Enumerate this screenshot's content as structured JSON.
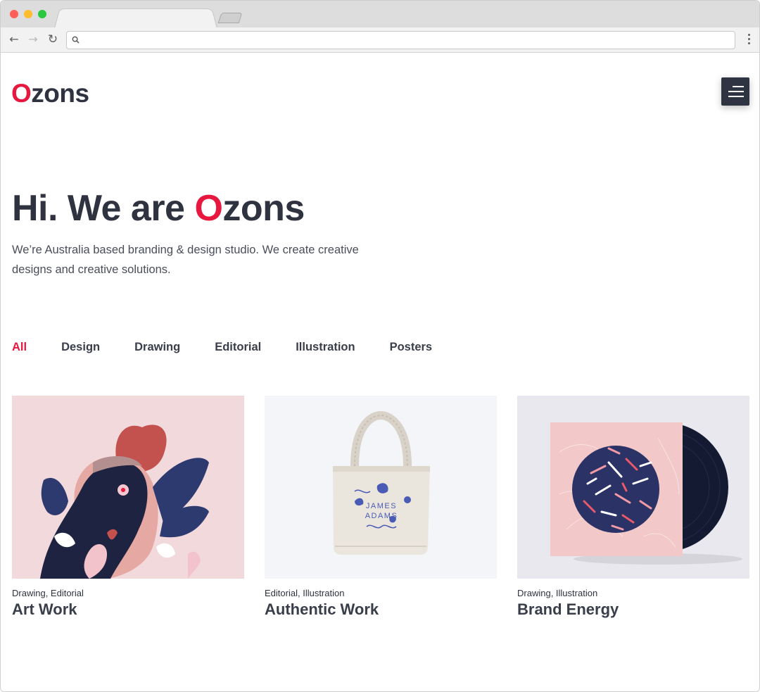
{
  "browser": {
    "url": ""
  },
  "site": {
    "logo_initial": "O",
    "logo_rest": "zons"
  },
  "hero": {
    "title_prefix": "Hi. We are ",
    "title_initial": "O",
    "title_rest": "zons",
    "subtitle": "We’re Australia based branding & design studio. We create creative designs and creative solutions."
  },
  "filters": [
    {
      "label": "All",
      "active": true
    },
    {
      "label": "Design",
      "active": false
    },
    {
      "label": "Drawing",
      "active": false
    },
    {
      "label": "Editorial",
      "active": false
    },
    {
      "label": "Illustration",
      "active": false
    },
    {
      "label": "Posters",
      "active": false
    }
  ],
  "portfolio": [
    {
      "categories": [
        "Drawing",
        "Editorial"
      ],
      "title": "Art Work"
    },
    {
      "categories": [
        "Editorial",
        "Illustration"
      ],
      "title": "Authentic Work"
    },
    {
      "categories": [
        "Drawing",
        "Illustration"
      ],
      "title": "Brand Energy"
    }
  ],
  "tote_text": {
    "line1": "JAMES",
    "line2": "ADAMS"
  },
  "colors": {
    "accent": "#e8173f",
    "text_dark": "#2f3340",
    "menu_button": "#2f3443"
  }
}
